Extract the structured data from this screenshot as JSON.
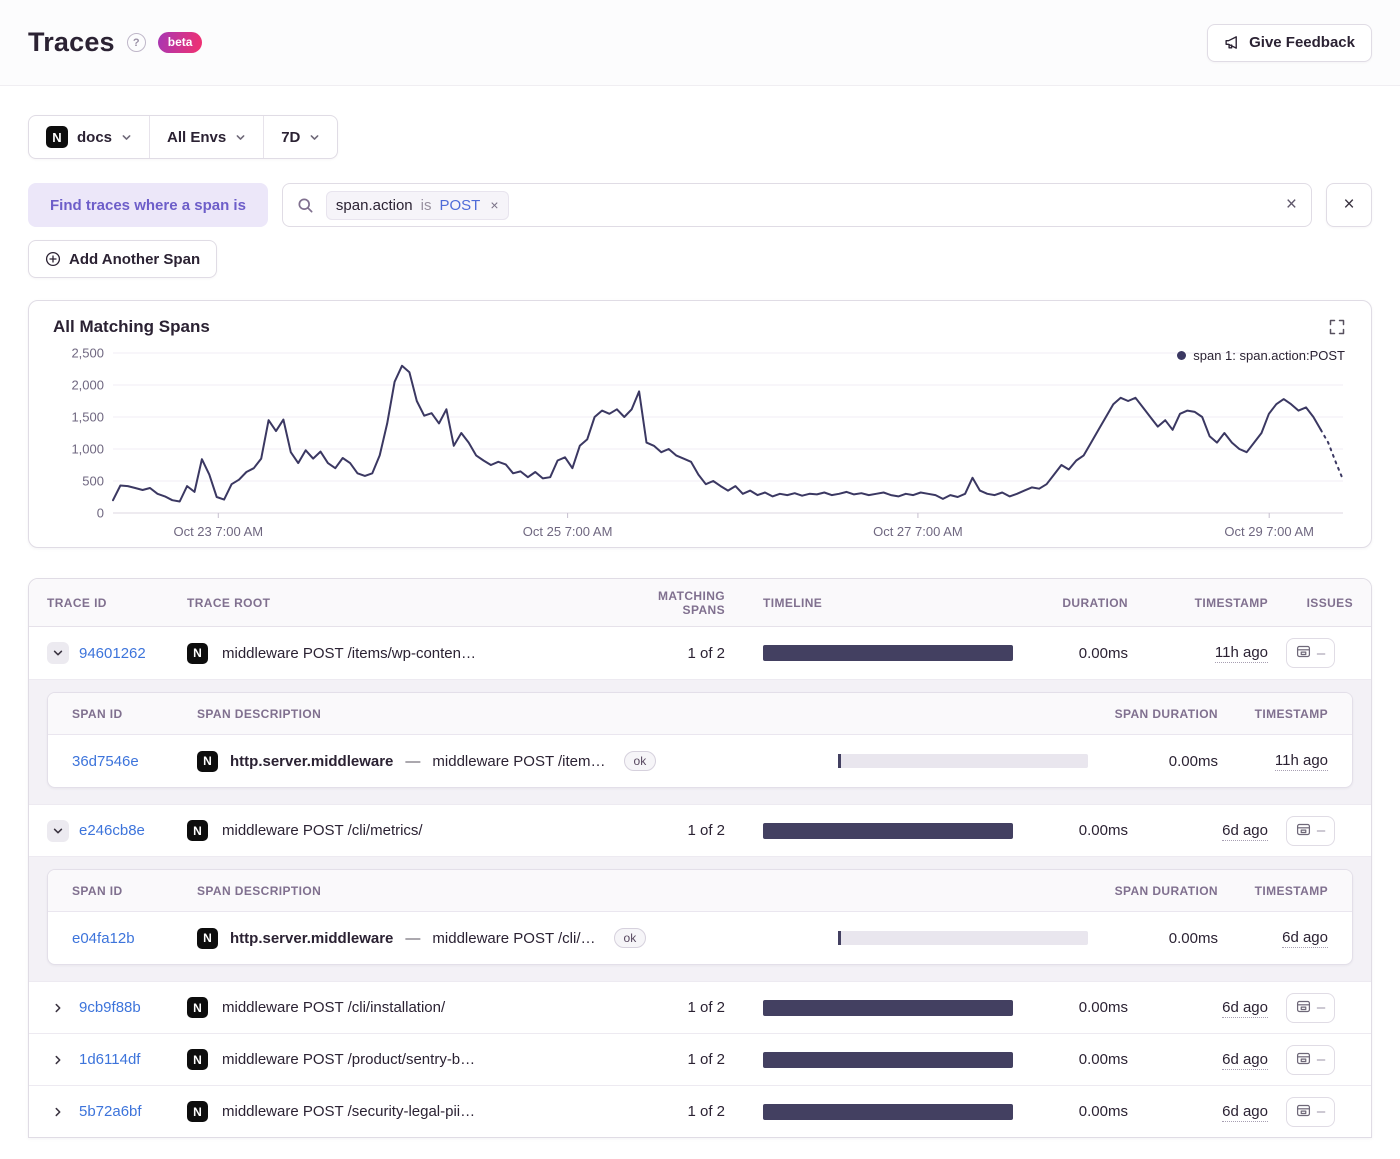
{
  "header": {
    "title": "Traces",
    "beta_label": "beta",
    "feedback_label": "Give Feedback",
    "help_icon": "?"
  },
  "filters": {
    "project": "docs",
    "environment": "All Envs",
    "date_range": "7D"
  },
  "span_query": {
    "label": "Find traces where a span is",
    "token": {
      "key": "span.action",
      "op": "is",
      "value": "POST"
    },
    "add_button_label": "Add Another Span"
  },
  "chart": {
    "title": "All Matching Spans",
    "legend": "span 1: span.action:POST"
  },
  "chart_data": {
    "type": "line",
    "title": "All Matching Spans",
    "series": [
      {
        "name": "span 1: span.action:POST",
        "color": "#3b3862",
        "values": [
          200,
          430,
          420,
          390,
          360,
          390,
          300,
          260,
          200,
          180,
          420,
          330,
          840,
          600,
          250,
          210,
          450,
          520,
          640,
          700,
          850,
          1450,
          1280,
          1460,
          950,
          780,
          980,
          850,
          960,
          780,
          700,
          860,
          780,
          620,
          580,
          620,
          900,
          1400,
          2050,
          2300,
          2200,
          1750,
          1520,
          1560,
          1400,
          1620,
          1050,
          1250,
          1100,
          900,
          820,
          750,
          800,
          760,
          620,
          650,
          560,
          640,
          540,
          560,
          820,
          870,
          700,
          1050,
          1150,
          1500,
          1600,
          1550,
          1620,
          1500,
          1620,
          1900,
          1100,
          1050,
          950,
          1000,
          900,
          850,
          800,
          600,
          450,
          500,
          420,
          350,
          420,
          300,
          350,
          280,
          320,
          260,
          300,
          280,
          310,
          270,
          300,
          290,
          320,
          280,
          300,
          330,
          290,
          310,
          280,
          300,
          320,
          280,
          260,
          300,
          280,
          320,
          300,
          280,
          220,
          280,
          250,
          300,
          550,
          350,
          300,
          280,
          320,
          260,
          300,
          350,
          400,
          380,
          450,
          600,
          750,
          680,
          820,
          900,
          1100,
          1300,
          1500,
          1700,
          1800,
          1750,
          1800,
          1650,
          1500,
          1350,
          1450,
          1300,
          1550,
          1600,
          1580,
          1500,
          1200,
          1100,
          1250,
          1100,
          1000,
          950,
          1100,
          1250,
          1550,
          1700,
          1780,
          1700,
          1600,
          1650,
          1500,
          1300,
          1100,
          800,
          520
        ]
      }
    ],
    "x_ticks": [
      {
        "label": "Oct 23 7:00 AM",
        "pos": 0.0856
      },
      {
        "label": "Oct 25 7:00 AM",
        "pos": 0.3696
      },
      {
        "label": "Oct 27 7:00 AM",
        "pos": 0.6544
      },
      {
        "label": "Oct 29 7:00 AM",
        "pos": 0.94
      }
    ],
    "y_ticks": [
      {
        "label": "0",
        "value": 0
      },
      {
        "label": "500",
        "value": 500
      },
      {
        "label": "1,000",
        "value": 1000
      },
      {
        "label": "1,500",
        "value": 1500
      },
      {
        "label": "2,000",
        "value": 2000
      },
      {
        "label": "2,500",
        "value": 2500
      }
    ],
    "ylim": [
      0,
      2500
    ],
    "grid": true,
    "legend_position": "top-right",
    "dashed_tail_points": 3
  },
  "table": {
    "columns": [
      "TRACE ID",
      "TRACE ROOT",
      "MATCHING SPANS",
      "TIMELINE",
      "DURATION",
      "TIMESTAMP",
      "ISSUES"
    ],
    "span_columns": [
      "SPAN ID",
      "SPAN DESCRIPTION",
      "SPAN DURATION",
      "TIMESTAMP"
    ],
    "span_separator": "—",
    "issues_placeholder": "–",
    "rows": [
      {
        "trace_id": "94601262",
        "expanded": true,
        "trace_root": "middleware POST /items/wp-conten…",
        "matching_spans": "1 of 2",
        "duration": "0.00ms",
        "timestamp": "11h ago",
        "spans": [
          {
            "span_id": "36d7546e",
            "operation": "http.server.middleware",
            "description": "middleware POST /item…",
            "status": "ok",
            "span_duration": "0.00ms",
            "timestamp": "11h ago"
          }
        ]
      },
      {
        "trace_id": "e246cb8e",
        "expanded": true,
        "trace_root": "middleware POST /cli/metrics/",
        "matching_spans": "1 of 2",
        "duration": "0.00ms",
        "timestamp": "6d ago",
        "spans": [
          {
            "span_id": "e04fa12b",
            "operation": "http.server.middleware",
            "description": "middleware POST /cli/…",
            "status": "ok",
            "span_duration": "0.00ms",
            "timestamp": "6d ago"
          }
        ]
      },
      {
        "trace_id": "9cb9f88b",
        "expanded": false,
        "trace_root": "middleware POST /cli/installation/",
        "matching_spans": "1 of 2",
        "duration": "0.00ms",
        "timestamp": "6d ago",
        "spans": []
      },
      {
        "trace_id": "1d6114df",
        "expanded": false,
        "trace_root": "middleware POST /product/sentry-b…",
        "matching_spans": "1 of 2",
        "duration": "0.00ms",
        "timestamp": "6d ago",
        "spans": []
      },
      {
        "trace_id": "5b72a6bf",
        "expanded": false,
        "trace_root": "middleware POST /security-legal-pii…",
        "matching_spans": "1 of 2",
        "duration": "0.00ms",
        "timestamp": "6d ago",
        "spans": []
      }
    ]
  },
  "colors": {
    "accent_purple": "#6d5ec9",
    "link_blue": "#3d74db",
    "chart_line": "#3b3862",
    "timeline_bar": "#434061",
    "beta_gradient_start": "#a737b4",
    "beta_gradient_end": "#f2306f",
    "border": "#e0dce5",
    "header_text": "#80708f"
  }
}
